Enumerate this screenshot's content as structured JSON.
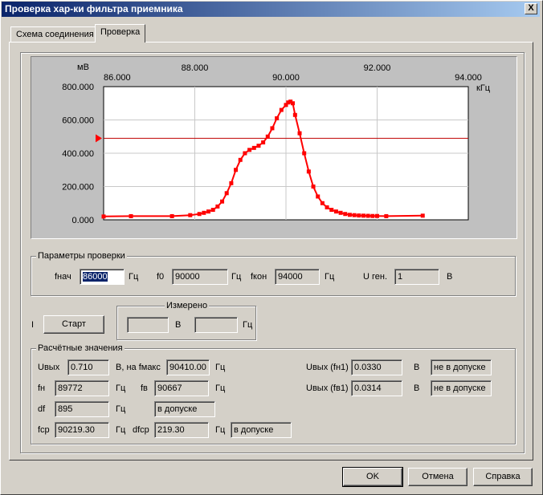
{
  "window": {
    "title": "Проверка хар-ки фильтра приемника",
    "close_label": "X"
  },
  "tabs": [
    {
      "label": "Схема соединения",
      "active": false
    },
    {
      "label": "Проверка",
      "active": true
    }
  ],
  "chart_data": {
    "type": "line",
    "ylabel": "мВ",
    "xlabel": "кГц",
    "x_ticks": [
      "86.000",
      "88.000",
      "90.000",
      "92.000",
      "94.000"
    ],
    "y_ticks": [
      "800.000",
      "600.000",
      "400.000",
      "200.000",
      "0.000"
    ],
    "xlim": [
      86000,
      94000
    ],
    "ylim": [
      0,
      800
    ],
    "threshold": 490,
    "grid": true,
    "line_color": "#ff0000",
    "threshold_color": "#c00000",
    "x": [
      86000,
      86600,
      87500,
      87900,
      88100,
      88200,
      88300,
      88400,
      88500,
      88600,
      88700,
      88800,
      88900,
      89000,
      89100,
      89200,
      89300,
      89400,
      89500,
      89600,
      89700,
      89800,
      89900,
      90000,
      90050,
      90100,
      90150,
      90200,
      90300,
      90400,
      90500,
      90600,
      90700,
      90800,
      90900,
      91000,
      91100,
      91200,
      91300,
      91400,
      91500,
      91600,
      91700,
      91800,
      91900,
      92000,
      92200,
      93000
    ],
    "y": [
      20,
      22,
      22,
      28,
      35,
      42,
      50,
      60,
      80,
      110,
      160,
      220,
      300,
      360,
      400,
      420,
      432,
      445,
      465,
      500,
      550,
      610,
      660,
      690,
      705,
      710,
      700,
      630,
      520,
      400,
      290,
      200,
      140,
      100,
      75,
      60,
      50,
      42,
      35,
      30,
      28,
      26,
      25,
      24,
      23,
      23,
      22,
      25
    ]
  },
  "params": {
    "title": "Параметры проверки",
    "fstart_label": "fнач",
    "fstart_value": "86000",
    "fstart_unit": "Гц",
    "f0_label": "f0",
    "f0_value": "90000",
    "f0_unit": "Гц",
    "fend_label": "fкон",
    "fend_value": "94000",
    "fend_unit": "Гц",
    "ugen_label": "U ген.",
    "ugen_value": "1",
    "ugen_unit": "В"
  },
  "control": {
    "indicator": "I",
    "start_label": "Старт",
    "measured_title": "Измерено",
    "measured_v_value": "",
    "measured_v_unit": "В",
    "measured_f_value": "",
    "measured_f_unit": "Гц"
  },
  "calc": {
    "title": "Расчётные значения",
    "uout_label": "Uвых",
    "uout_value": "0.710",
    "uout_unit": "В, на fмакс",
    "fmax_value": "90410.00",
    "fmax_unit": "Гц",
    "uout_fn1_label": "Uвых (fн1)",
    "uout_fn1_value": "0.0330",
    "uout_fn1_unit": "В",
    "uout_fn1_status": "не в допуске",
    "fn_label": "fн",
    "fn_value": "89772",
    "fn_unit": "Гц",
    "fv_label": "fв",
    "fv_value": "90667",
    "fv_unit": "Гц",
    "uout_fv1_label": "Uвых (fв1)",
    "uout_fv1_value": "0.0314",
    "uout_fv1_unit": "В",
    "uout_fv1_status": "не в допуске",
    "df_label": "df",
    "df_value": "895",
    "df_unit": "Гц",
    "df_status": "в допуске",
    "fcp_label": "fср",
    "fcp_value": "90219.30",
    "fcp_unit": "Гц",
    "dfcp_label": "dfср",
    "dfcp_value": "219.30",
    "dfcp_unit": "Гц",
    "dfcp_status": "в допуске"
  },
  "footer": {
    "ok_label": "OK",
    "cancel_label": "Отмена",
    "help_label": "Справка"
  }
}
